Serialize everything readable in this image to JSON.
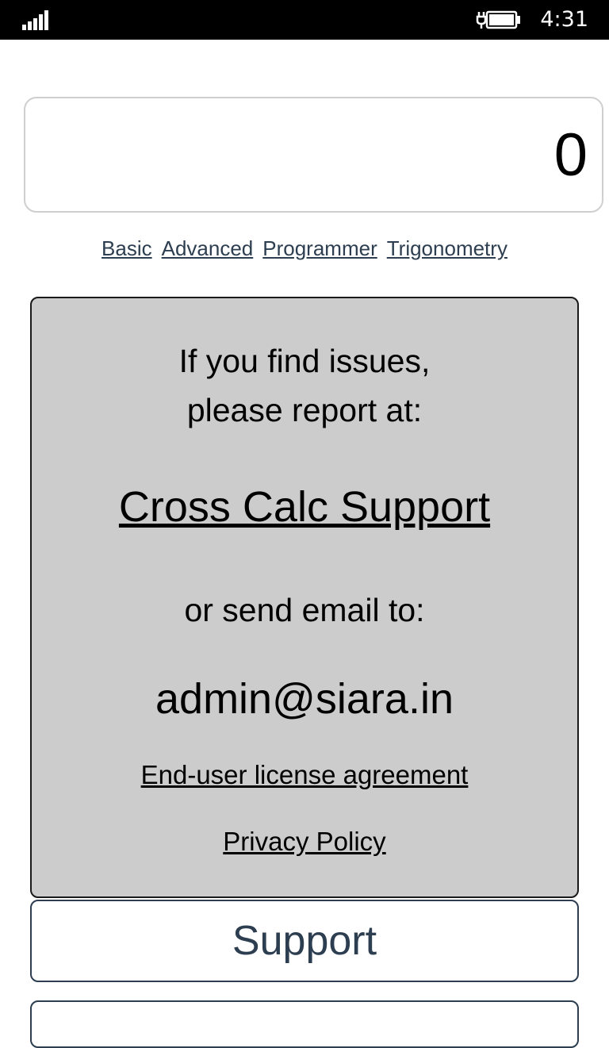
{
  "status_bar": {
    "time": "4:31",
    "signal_icon": "cellular-signal-icon",
    "battery_icon": "battery-charging-icon"
  },
  "display": {
    "value": "0"
  },
  "modes": [
    {
      "label": "Basic"
    },
    {
      "label": "Advanced"
    },
    {
      "label": "Programmer"
    },
    {
      "label": "Trigonometry"
    }
  ],
  "info": {
    "line1": "If you find issues,",
    "line2": "please report at:",
    "support_link": "Cross Calc Support",
    "email_label": "or send email to:",
    "email": "admin@siara.in",
    "eula_link": "End-user license agreement",
    "privacy_link": "Privacy Policy"
  },
  "buttons": {
    "support": "Support"
  },
  "colors": {
    "accent": "#2c3e50",
    "panel": "#cccccc",
    "statusbar": "#000000"
  }
}
